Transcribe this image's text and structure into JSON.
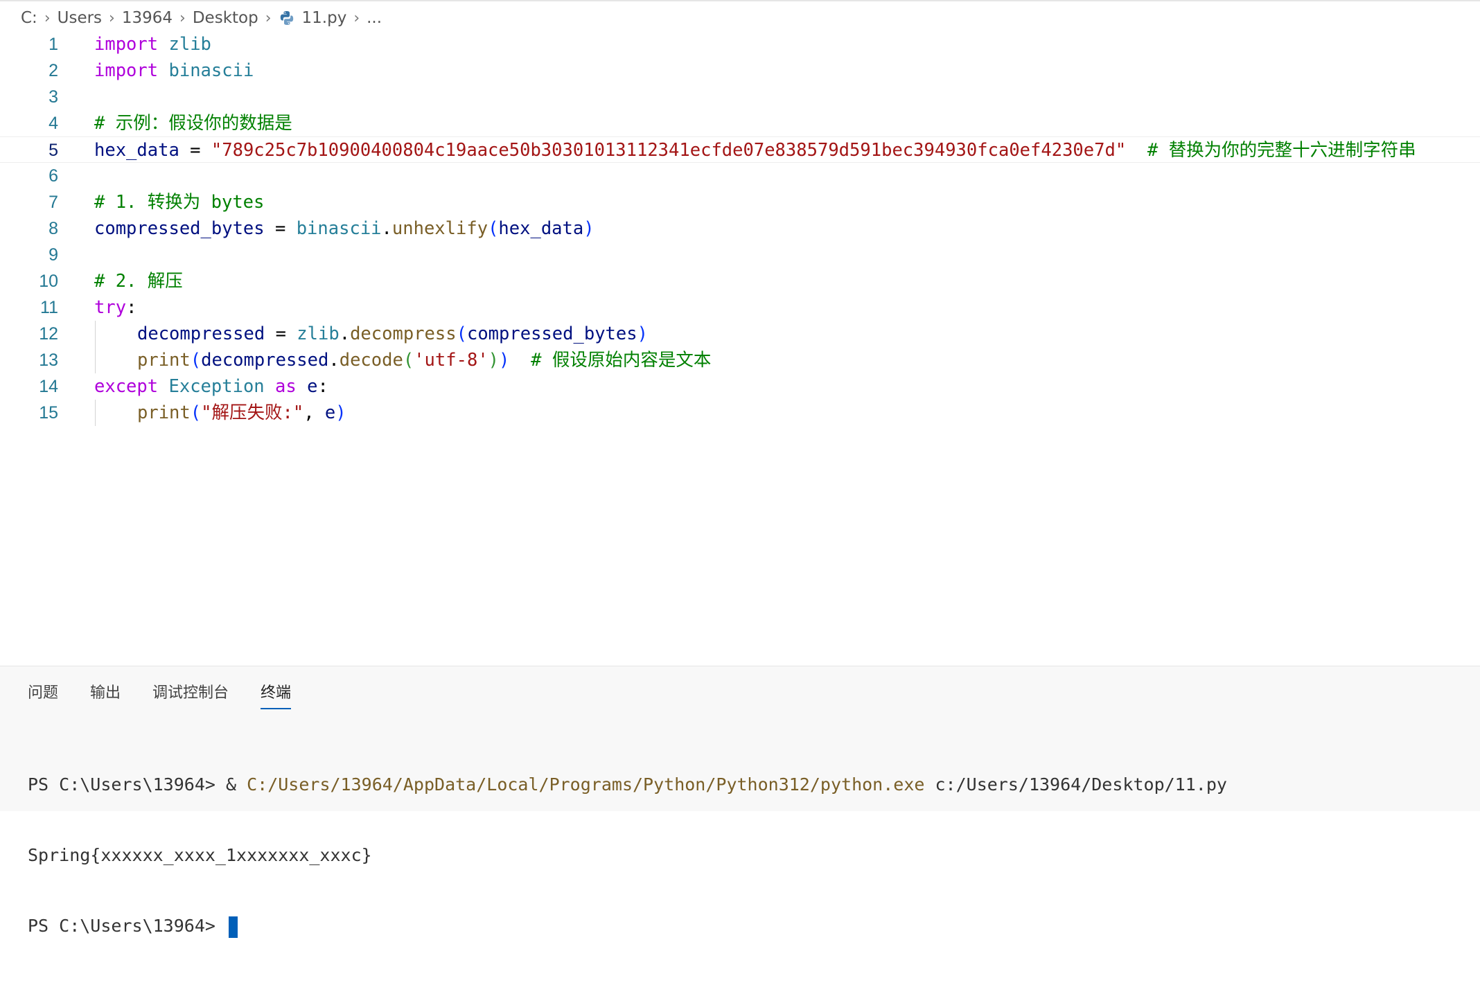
{
  "breadcrumb": {
    "items": [
      "C:",
      "Users",
      "13964",
      "Desktop",
      "11.py",
      "..."
    ]
  },
  "editor": {
    "current_line": 5,
    "lines": [
      {
        "n": "1",
        "tokens": [
          [
            "kw",
            "import"
          ],
          [
            "op",
            " "
          ],
          [
            "mod",
            "zlib"
          ]
        ]
      },
      {
        "n": "2",
        "tokens": [
          [
            "kw",
            "import"
          ],
          [
            "op",
            " "
          ],
          [
            "mod",
            "binascii"
          ]
        ]
      },
      {
        "n": "3",
        "tokens": []
      },
      {
        "n": "4",
        "tokens": [
          [
            "cm",
            "# 示例：假设你的数据是"
          ]
        ]
      },
      {
        "n": "5",
        "tokens": [
          [
            "var",
            "hex_data"
          ],
          [
            "op",
            " = "
          ],
          [
            "str",
            "\"789c25c7b10900400804c19aace50b30301013112341ecfde07e838579d591bec394930fca0ef4230e7d\""
          ],
          [
            "op",
            "  "
          ],
          [
            "cm",
            "# 替换为你的完整十六进制字符串"
          ]
        ]
      },
      {
        "n": "6",
        "tokens": []
      },
      {
        "n": "7",
        "tokens": [
          [
            "cm",
            "# 1. 转换为 bytes"
          ]
        ]
      },
      {
        "n": "8",
        "tokens": [
          [
            "var",
            "compressed_bytes"
          ],
          [
            "op",
            " = "
          ],
          [
            "mod",
            "binascii"
          ],
          [
            "op",
            "."
          ],
          [
            "fn",
            "unhexlify"
          ],
          [
            "p1",
            "("
          ],
          [
            "var",
            "hex_data"
          ],
          [
            "p1",
            ")"
          ]
        ]
      },
      {
        "n": "9",
        "tokens": []
      },
      {
        "n": "10",
        "tokens": [
          [
            "cm",
            "# 2. 解压"
          ]
        ]
      },
      {
        "n": "11",
        "tokens": [
          [
            "kw",
            "try"
          ],
          [
            "op",
            ":"
          ]
        ]
      },
      {
        "n": "12",
        "indent": true,
        "tokens": [
          [
            "var",
            "decompressed"
          ],
          [
            "op",
            " = "
          ],
          [
            "mod",
            "zlib"
          ],
          [
            "op",
            "."
          ],
          [
            "fn",
            "decompress"
          ],
          [
            "p1",
            "("
          ],
          [
            "var",
            "compressed_bytes"
          ],
          [
            "p1",
            ")"
          ]
        ]
      },
      {
        "n": "13",
        "indent": true,
        "tokens": [
          [
            "fn",
            "print"
          ],
          [
            "p1",
            "("
          ],
          [
            "var",
            "decompressed"
          ],
          [
            "op",
            "."
          ],
          [
            "fn",
            "decode"
          ],
          [
            "p2",
            "("
          ],
          [
            "str",
            "'utf-8'"
          ],
          [
            "p2",
            ")"
          ],
          [
            "p1",
            ")"
          ],
          [
            "op",
            "  "
          ],
          [
            "cm",
            "# 假设原始内容是文本"
          ]
        ]
      },
      {
        "n": "14",
        "tokens": [
          [
            "kw",
            "except"
          ],
          [
            "op",
            " "
          ],
          [
            "mod",
            "Exception"
          ],
          [
            "op",
            " "
          ],
          [
            "kw",
            "as"
          ],
          [
            "op",
            " "
          ],
          [
            "var",
            "e"
          ],
          [
            "op",
            ":"
          ]
        ]
      },
      {
        "n": "15",
        "indent": true,
        "tokens": [
          [
            "fn",
            "print"
          ],
          [
            "p1",
            "("
          ],
          [
            "str",
            "\"解压失败:\""
          ],
          [
            "op",
            ", "
          ],
          [
            "var",
            "e"
          ],
          [
            "p1",
            ")"
          ]
        ]
      }
    ]
  },
  "panel": {
    "tabs": [
      "问题",
      "输出",
      "调试控制台",
      "终端"
    ],
    "active_tab": 3
  },
  "terminal": {
    "line1_prompt": "PS C:\\Users\\13964> ",
    "line1_amp": "& ",
    "line1_exe": "C:/Users/13964/AppData/Local/Programs/Python/Python312/python.exe",
    "line1_arg": " c:/Users/13964/Desktop/11.py",
    "line2": "Spring{xxxxxx_xxxx_1xxxxxxx_xxxc}",
    "line3_prompt": "PS C:\\Users\\13964> "
  },
  "colors": {
    "keyword": "#af00db",
    "module": "#267f99",
    "variable": "#001080",
    "function": "#795e26",
    "string": "#a31515",
    "comment": "#008000",
    "line_number": "#237893",
    "accent": "#005fb8"
  },
  "icons": {
    "file": "python-file-icon"
  }
}
